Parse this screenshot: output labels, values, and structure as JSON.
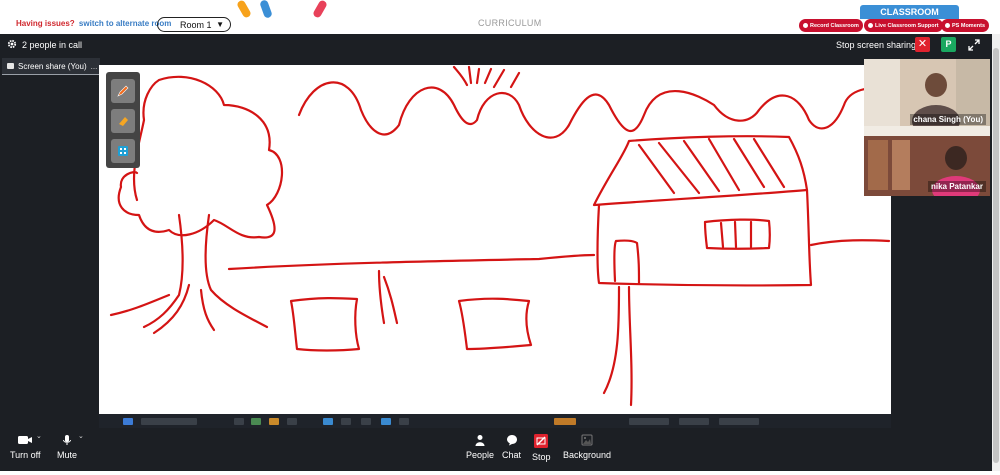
{
  "header": {
    "issue_text": "Having issues?",
    "alternate_link": "switch to alternate room",
    "room_select": "Room 1",
    "curriculum": "CURRICULUM",
    "classroom_tab": "CLASSROOM",
    "buttons": [
      "Record Classroom",
      "Live Classroom Support",
      "PS Moments"
    ]
  },
  "meeting": {
    "people_count": "2 people in call",
    "stop_sharing": "Stop screen sharing",
    "participant_badge": "P",
    "share_tab_label": "Screen share (You)",
    "share_tab_more": "...",
    "participants": [
      {
        "name": "chana Singh (You)"
      },
      {
        "name": "nika Patankar"
      }
    ],
    "controls": {
      "turn_off": "Turn off",
      "mute": "Mute",
      "people": "People",
      "chat": "Chat",
      "stop": "Stop",
      "background": "Background"
    }
  },
  "colors": {
    "brand_red": "#c8102e",
    "classroom_blue": "#3b8fd6",
    "drawing_red": "#d41414",
    "meeting_bg": "#1c1f24"
  }
}
